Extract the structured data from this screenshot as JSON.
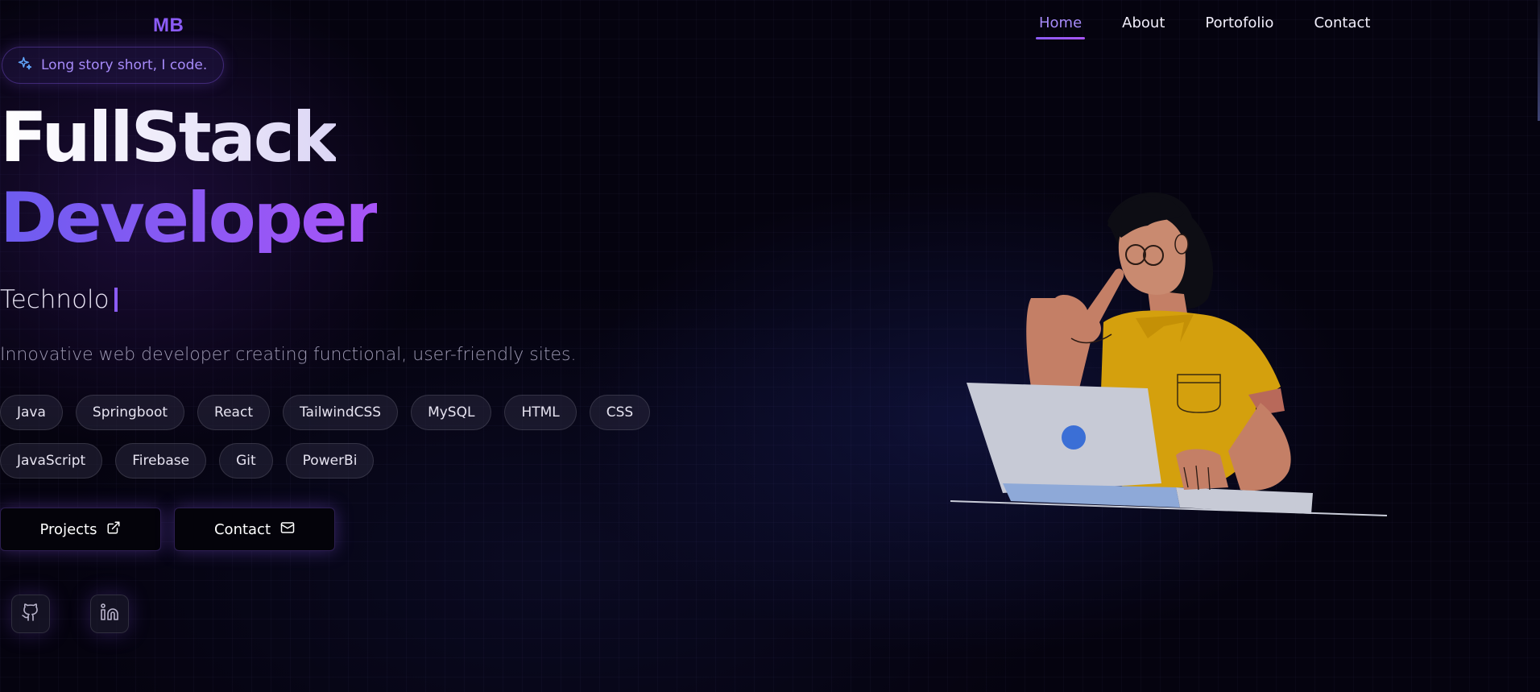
{
  "logo": "MB",
  "nav": {
    "items": [
      {
        "label": "Home"
      },
      {
        "label": "About"
      },
      {
        "label": "Portofolio"
      },
      {
        "label": "Contact"
      }
    ]
  },
  "hero": {
    "badge": "Long story short, I code.",
    "title_line1": "FullStack",
    "title_line2": "Developer",
    "typed_text": "Technolo",
    "tagline": "Innovative web developer creating functional, user-friendly sites.",
    "skills": [
      "Java",
      "Springboot",
      "React",
      "TailwindCSS",
      "MySQL",
      "HTML",
      "CSS",
      "JavaScript",
      "Firebase",
      "Git",
      "PowerBi"
    ],
    "buttons": {
      "projects_label": "Projects",
      "contact_label": "Contact"
    },
    "socials": [
      "github-icon",
      "linkedin-icon"
    ]
  },
  "colors": {
    "accent": "#8b5cf6",
    "background": "#05030f"
  }
}
